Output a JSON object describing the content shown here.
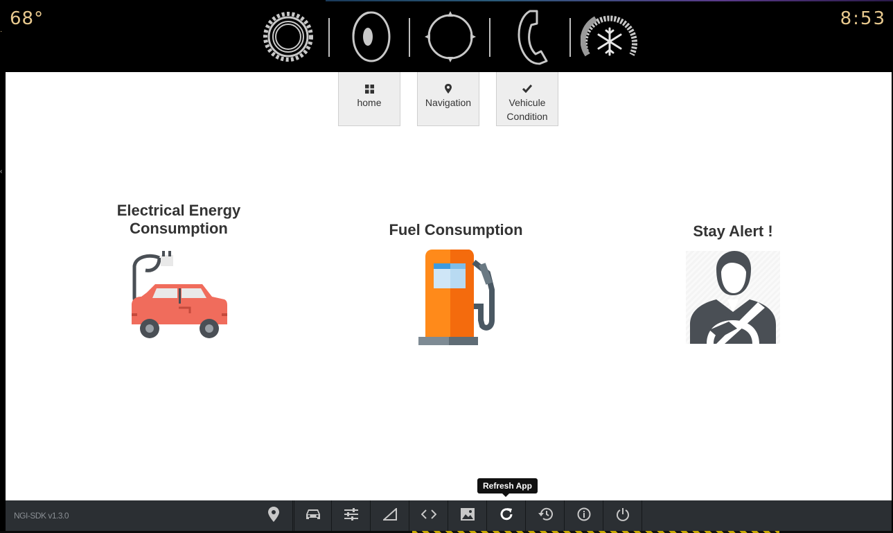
{
  "status": {
    "temperature": "68°",
    "time": "8:53"
  },
  "top_icons": [
    "settings-gear-icon",
    "audio-speaker-icon",
    "navigation-compass-icon",
    "phone-handset-icon",
    "climate-fan-icon"
  ],
  "nav": [
    {
      "icon": "grid-icon",
      "label": "home"
    },
    {
      "icon": "map-pin-icon",
      "label": "Navigation"
    },
    {
      "icon": "checkmark-icon",
      "label": "Vehicule Condition"
    }
  ],
  "cards": [
    {
      "title": "Electrical Energy Consumption",
      "icon": "electric-car-icon"
    },
    {
      "title": "Fuel Consumption",
      "icon": "fuel-pump-icon"
    },
    {
      "title": "Stay Alert !",
      "icon": "driver-alert-icon"
    }
  ],
  "sdk": {
    "version": "NGI-SDK v1.3.0"
  },
  "toolbar": {
    "buttons": [
      "location-icon",
      "car-icon",
      "sliders-icon",
      "signal-icon",
      "code-icon",
      "image-icon",
      "refresh-icon",
      "history-icon",
      "info-icon",
      "power-icon"
    ],
    "tooltip": "Refresh App"
  },
  "colors": {
    "accent_text": "#e8c98e",
    "car": "#f06c5c",
    "pump": "#ff8a1a",
    "toolbar_bg": "#2b2f33"
  }
}
